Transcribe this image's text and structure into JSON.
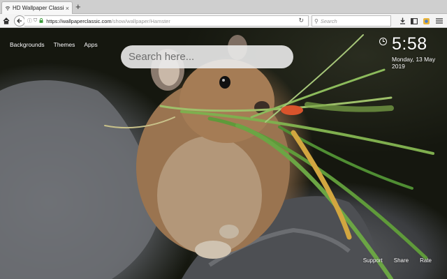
{
  "browser": {
    "tab_title": "HD Wallpaper Classic - Ham",
    "new_tab_symbol": "+",
    "url_domain": "https://wallpaperclassic.com",
    "url_path": "/show/wallpaper/Hamster",
    "search_placeholder": "Search",
    "icons": [
      "home-icon",
      "back-icon",
      "info-icon",
      "shield-icon",
      "lock-icon",
      "reload-icon",
      "search-icon",
      "download-icon",
      "sidebar-icon",
      "extension-icon",
      "menu-icon"
    ]
  },
  "page": {
    "nav": {
      "backgrounds": "Backgrounds",
      "themes": "Themes",
      "apps": "Apps"
    },
    "search_placeholder": "Search here...",
    "clock": {
      "time": "5:58",
      "date": "Monday, 13 May 2019"
    },
    "footer": {
      "support": "Support",
      "share": "Share",
      "rate": "Rate"
    },
    "background_subject": "pika-with-grass-photo"
  },
  "colors": {
    "tabbar": "#cfcfcf",
    "navbar": "#f4f4f4",
    "search_pill": "#ebebeb",
    "text_light": "#ffffff"
  }
}
